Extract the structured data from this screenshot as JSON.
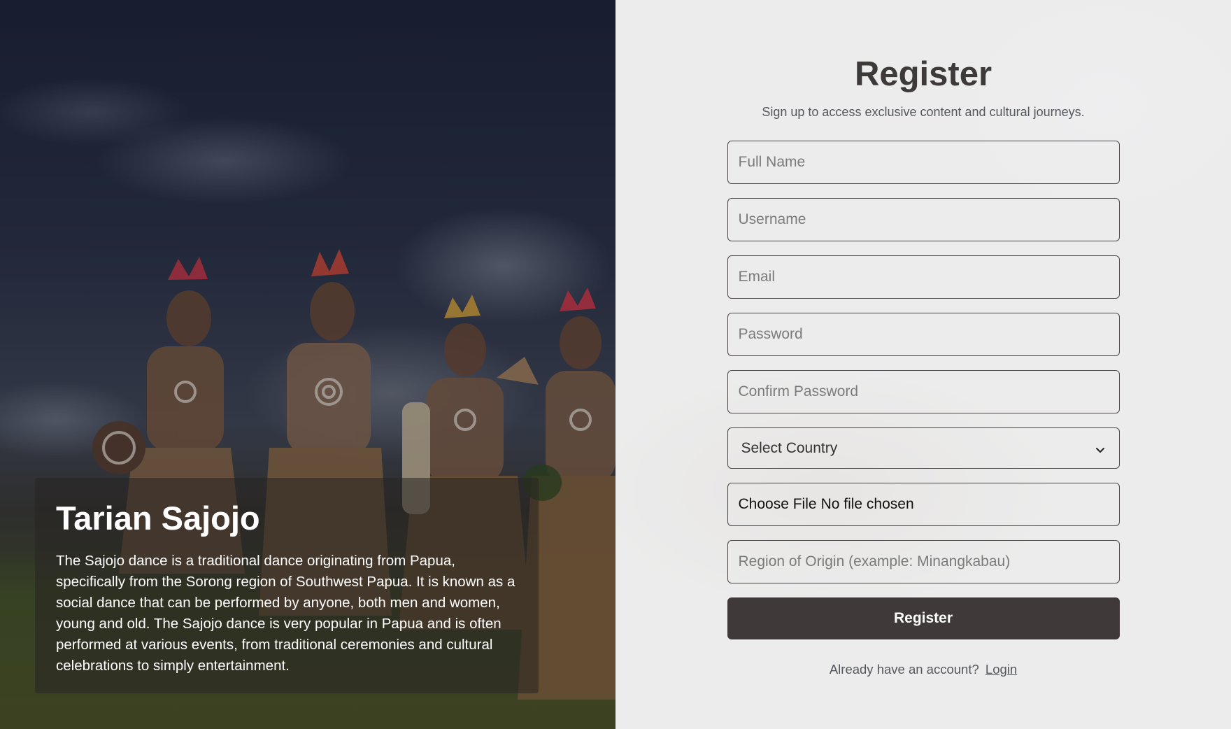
{
  "hero": {
    "title": "Tarian Sajojo",
    "description": "The Sajojo dance is a traditional dance originating from Papua, specifically from the Sorong region of Southwest Papua. It is known as a social dance that can be performed by anyone, both men and women, young and old. The Sajojo dance is very popular in Papua and is often performed at various events, from traditional ceremonies and cultural celebrations to simply entertainment."
  },
  "form": {
    "title": "Register",
    "subtitle": "Sign up to access exclusive content and cultural journeys.",
    "full_name_placeholder": "Full Name",
    "username_placeholder": "Username",
    "email_placeholder": "Email",
    "password_placeholder": "Password",
    "confirm_password_placeholder": "Confirm Password",
    "country_selected": "Select Country",
    "file_button_label": "Choose File",
    "file_status": "No file chosen",
    "region_placeholder": "Region of Origin (example: Minangkabau)",
    "submit_label": "Register",
    "login_prompt": "Already have an account?",
    "login_link": "Login"
  },
  "icons": {
    "select_chevron": "chevron-down-icon"
  },
  "colors": {
    "button_bg": "#3f3a39",
    "title_color": "#3d3a39",
    "panel_bg": "#ececec"
  }
}
